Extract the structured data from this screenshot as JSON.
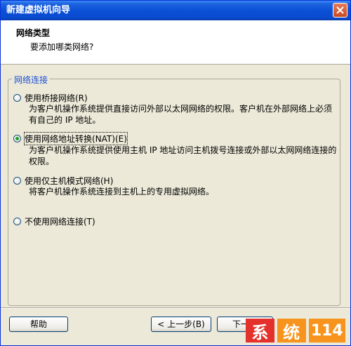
{
  "window": {
    "title": "新建虚拟机向导"
  },
  "header": {
    "title": "网络类型",
    "subtitle": "要添加哪类网络?"
  },
  "group": {
    "legend": "网络连接",
    "options": [
      {
        "label": "使用桥接网络(R)",
        "description": [
          "为客户机操作系统提供直接访问外部以太网网络的权限。客户机在外部网络上必须",
          "有自己的 IP 地址。"
        ],
        "selected": false
      },
      {
        "label": "使用网络地址转换(NAT)(E)",
        "description": [
          "为客户机操作系统提供使用主机 IP 地址访问主机拨号连接或外部以太网网络连接的",
          "权限。"
        ],
        "selected": true
      },
      {
        "label": "使用仅主机模式网络(H)",
        "description": [
          "将客户机操作系统连接到主机上的专用虚拟网络。"
        ],
        "selected": false
      },
      {
        "label": "不使用网络连接(T)",
        "description": [],
        "selected": false
      }
    ]
  },
  "buttons": {
    "help": "帮助",
    "back": "< 上一步(B)",
    "next": "下一步"
  },
  "watermark": {
    "text1": "系",
    "text2": "统",
    "text3": "114"
  },
  "colors": {
    "title_bar": "#0a50d6",
    "legend": "#2152d6",
    "watermark_red": "#e4312b",
    "watermark_orange": "#f7941d"
  }
}
